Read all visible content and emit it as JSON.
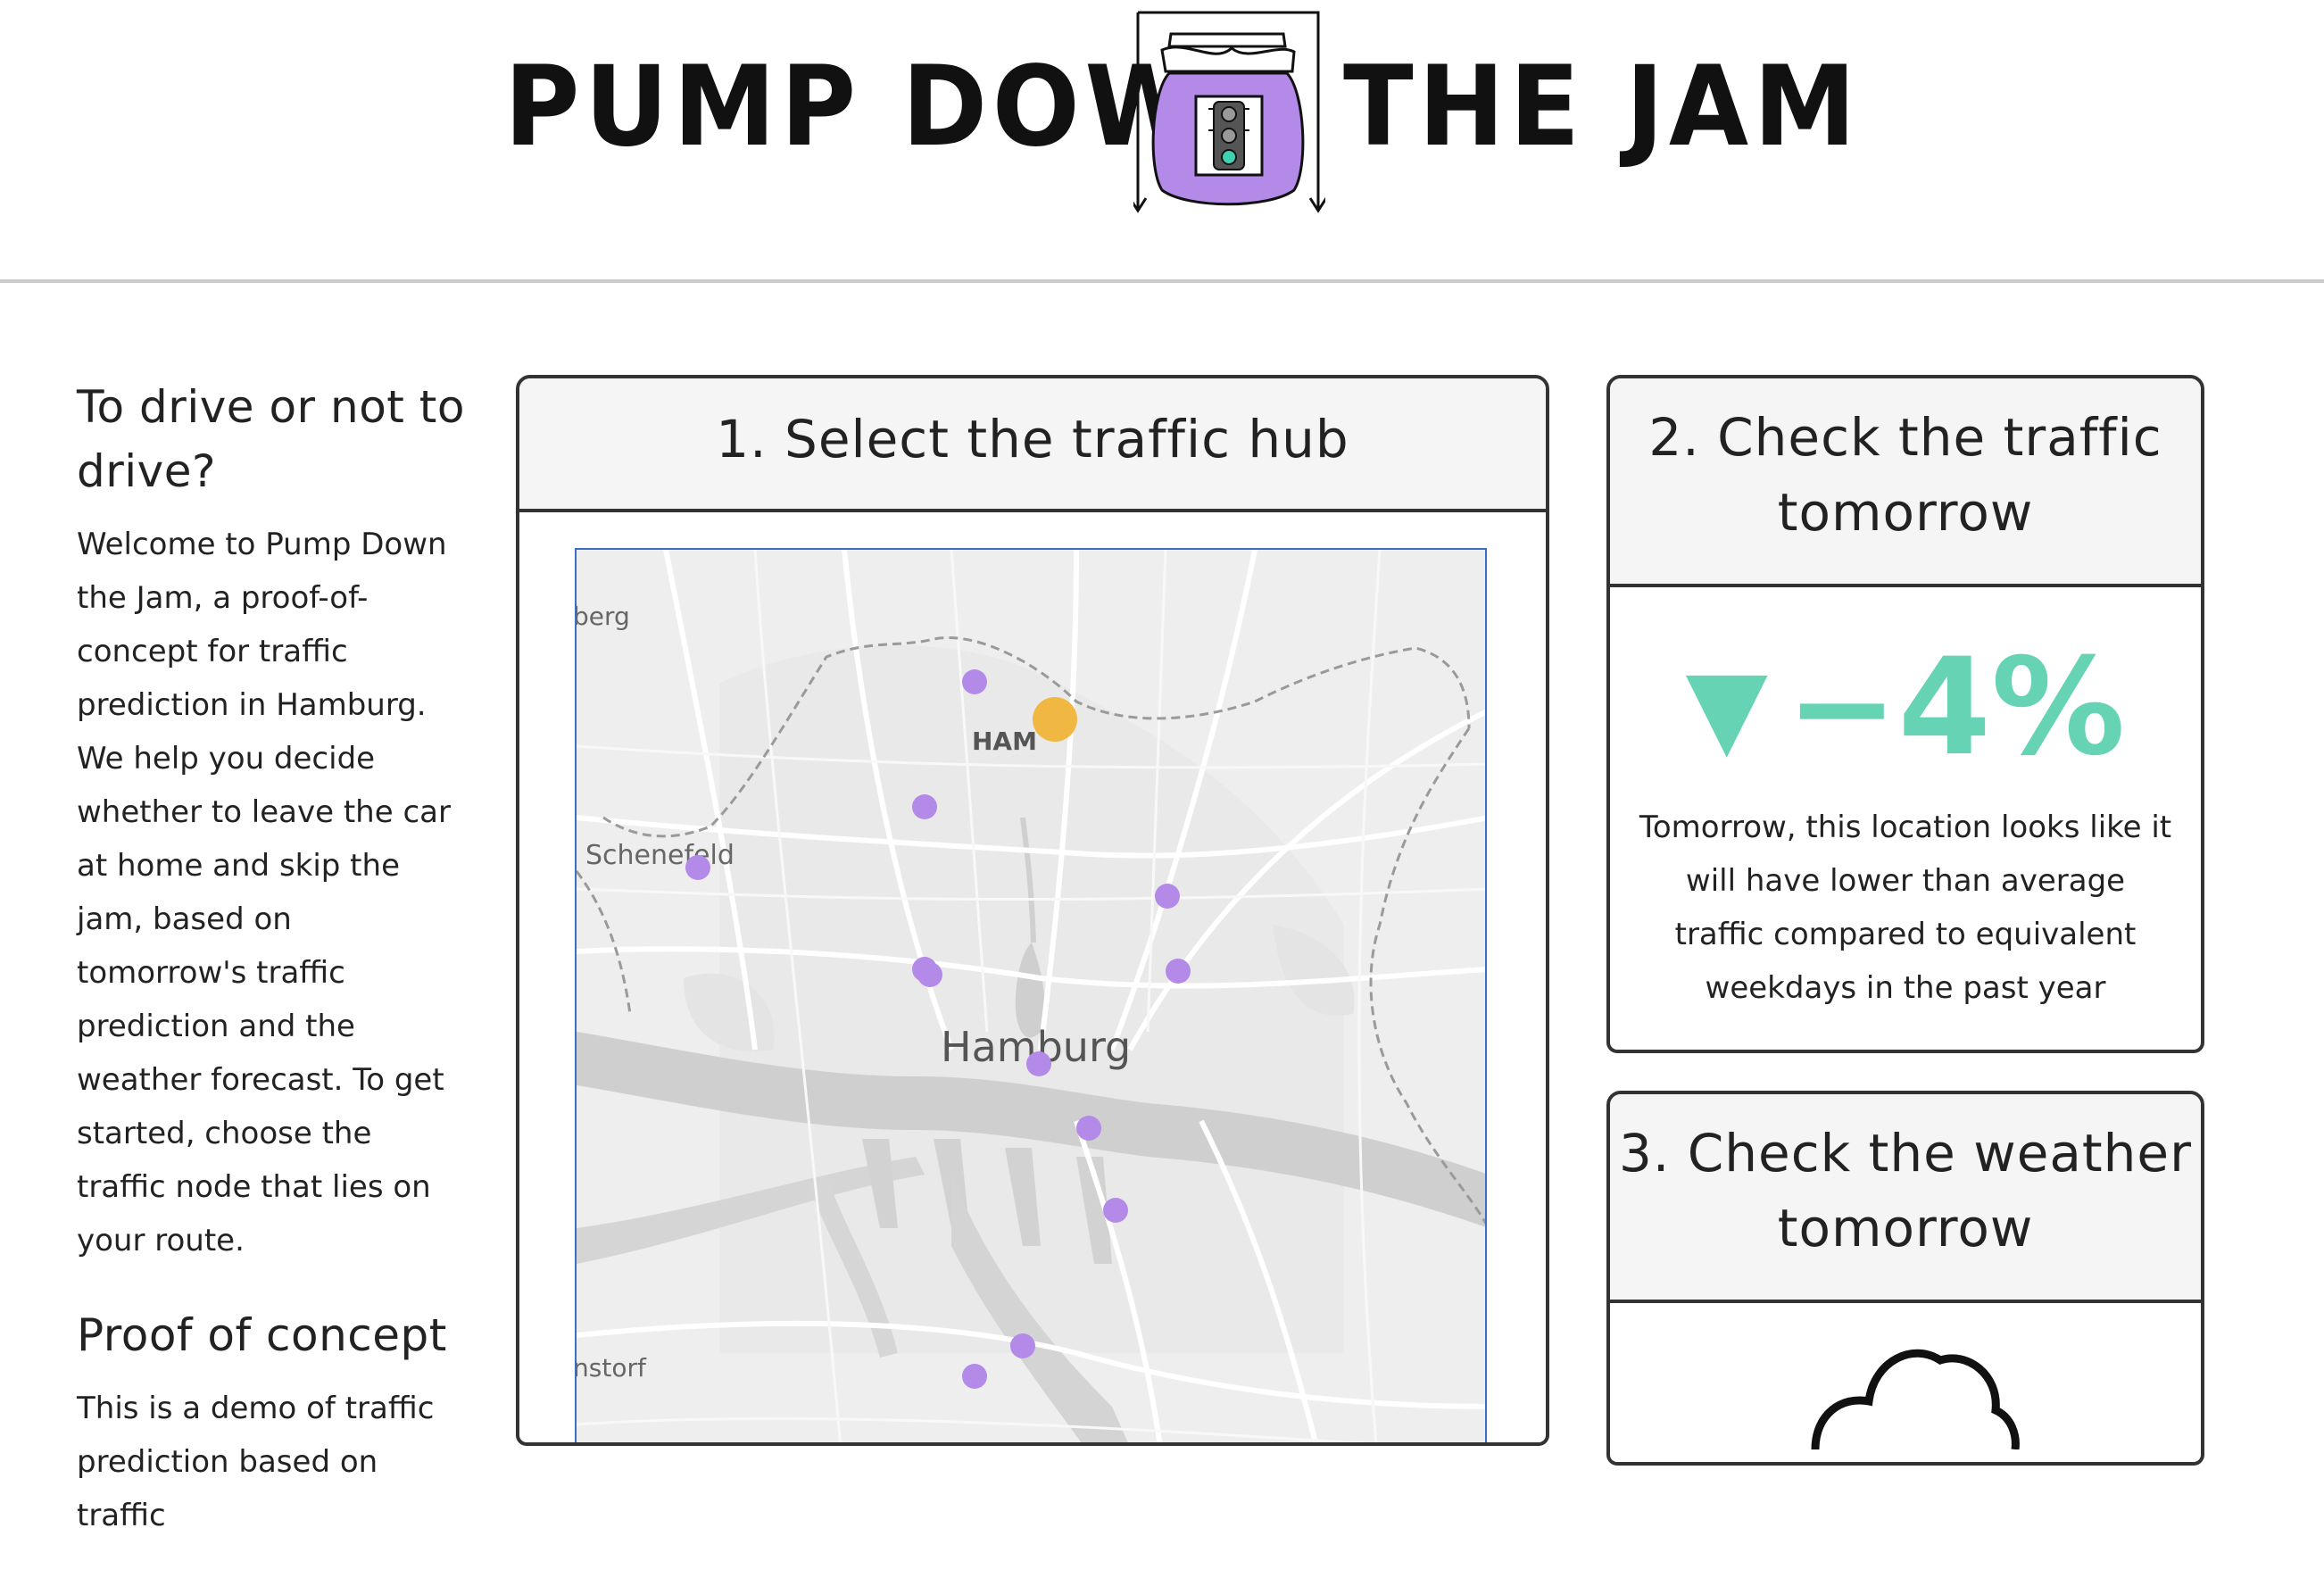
{
  "header": {
    "title_left": "PUMP DOWN",
    "title_right": "THE JAM",
    "logo_icon": "jam-jar-traffic-light-icon"
  },
  "sidebar": {
    "heading1": "To drive or not to drive?",
    "text1": "Welcome to Pump Down the Jam, a proof-of-concept for traffic prediction in Hamburg. We help you decide whether to leave the car at home and skip the jam, based on tomorrow's traffic prediction and the weather forecast. To get started, choose the traffic node that lies on your route.",
    "heading2": "Proof of concept",
    "text2": "This is a demo of traffic prediction based on traffic"
  },
  "map_card": {
    "title": "1. Select the traffic hub",
    "labels": {
      "berg": "berg",
      "ham": "HAM",
      "schenefeld": "Schenefeld",
      "hamburg": "Hamburg",
      "storf": "nstorf"
    },
    "hub_count": 13,
    "selected_hub_color": "#f0b843",
    "hub_color": "#b38ae8"
  },
  "traffic_card": {
    "title": "2. Check the traffic tomorrow",
    "arrow": "▼",
    "value": "−4%",
    "description": "Tomorrow, this location looks like it will have lower than average traffic compared to equivalent weekdays in the past year",
    "accent_color": "#66d4b4"
  },
  "weather_card": {
    "title": "3. Check the weather tomorrow",
    "icon": "cloud-icon"
  }
}
